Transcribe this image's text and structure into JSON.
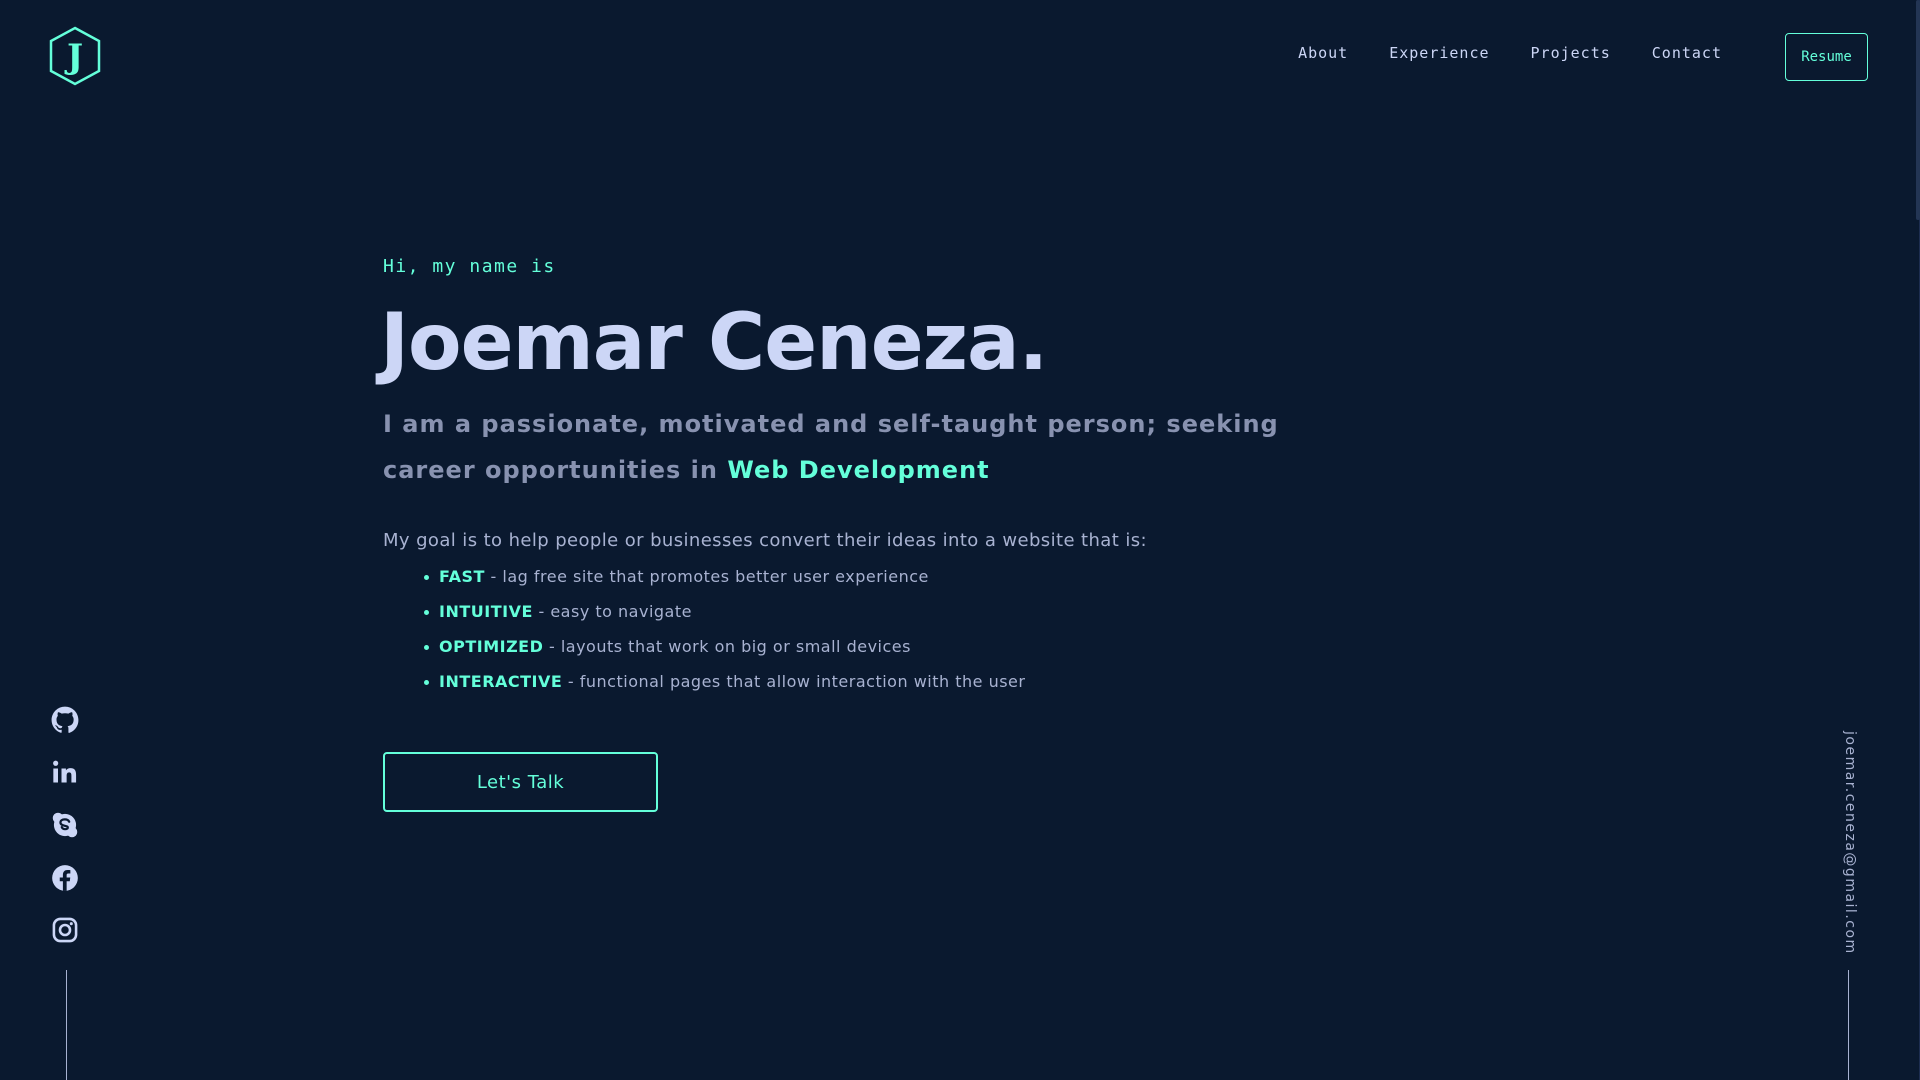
{
  "header": {
    "logo_letter": "J",
    "nav": [
      "About",
      "Experience",
      "Projects",
      "Contact"
    ],
    "resume_label": "Resume"
  },
  "hero": {
    "greeting": "Hi, my name is",
    "name": "Joemar Ceneza.",
    "tagline_prefix": "I am a passionate, motivated and self-taught person; seeking career opportunities in ",
    "tagline_highlight": "Web Development",
    "goal": "My goal is to help people or businesses convert their ideas into a website that is:",
    "points": [
      {
        "term": "FAST",
        "desc": " - lag free site that promotes better user experience"
      },
      {
        "term": "INTUITIVE",
        "desc": " - easy to navigate"
      },
      {
        "term": "OPTIMIZED",
        "desc": " - layouts that work on big or small devices"
      },
      {
        "term": "INTERACTIVE",
        "desc": " - functional pages that allow interaction with the user"
      }
    ],
    "cta_label": "Let's Talk"
  },
  "socials": [
    "github-icon",
    "linkedin-icon",
    "skype-icon",
    "facebook-icon",
    "instagram-icon"
  ],
  "email": "joemar.ceneza@gmail.com",
  "colors": {
    "background": "#0a192f",
    "accent": "#64ffda",
    "heading": "#ccd6f6",
    "body_text": "#8892b0",
    "light_text": "#a8b2d1"
  }
}
